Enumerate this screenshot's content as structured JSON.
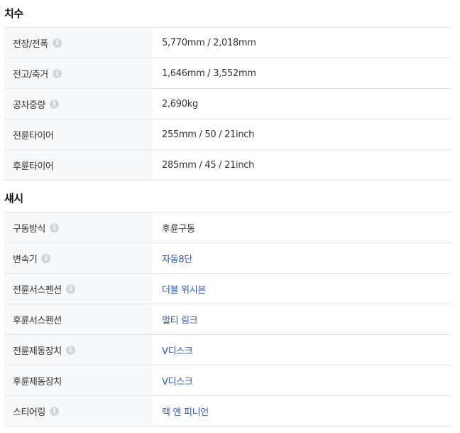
{
  "sections": [
    {
      "title": "치수",
      "rows": [
        {
          "label": "전장/전폭",
          "value": "5,770mm / 2,018mm",
          "info": true,
          "link": false
        },
        {
          "label": "전고/축거",
          "value": "1,646mm / 3,552mm",
          "info": true,
          "link": false
        },
        {
          "label": "공차중량",
          "value": "2,690kg",
          "info": true,
          "link": false
        },
        {
          "label": "전륜타이어",
          "value": "255mm / 50 / 21inch",
          "info": false,
          "link": false
        },
        {
          "label": "후륜타이어",
          "value": "285mm / 45 / 21inch",
          "info": false,
          "link": false
        }
      ]
    },
    {
      "title": "섀시",
      "rows": [
        {
          "label": "구동방식",
          "value": "후륜구동",
          "info": true,
          "link": false
        },
        {
          "label": "변속기",
          "value": "자동8단",
          "info": true,
          "link": true
        },
        {
          "label": "전륜서스펜션",
          "value": "더블 위시본",
          "info": true,
          "link": true
        },
        {
          "label": "후륜서스펜션",
          "value": "멀티 링크",
          "info": false,
          "link": true
        },
        {
          "label": "전륜제동장치",
          "value": "V디스크",
          "info": true,
          "link": true
        },
        {
          "label": "후륜제동장치",
          "value": "V디스크",
          "info": false,
          "link": true
        },
        {
          "label": "스티어링",
          "value": "랙 앤 피니언",
          "info": true,
          "link": true
        }
      ]
    }
  ],
  "icons": {
    "info": "info-icon"
  },
  "colors": {
    "link": "#2f58b8",
    "label_bg": "#f7f8fa",
    "divider": "#e3e5e8",
    "info_icon": "#d2d5da"
  }
}
